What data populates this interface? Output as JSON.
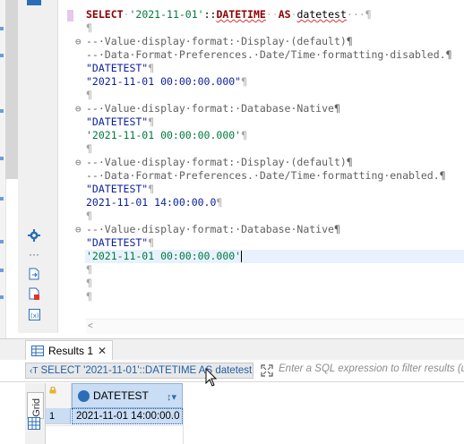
{
  "editor": {
    "lines": [
      {
        "type": "select",
        "kw1": "SELECT",
        "str": "'2021-11-01'",
        "op": "::",
        "kw2": "DATETIME",
        "kw3": "AS",
        "alias": "datetest",
        "trail": "···¶"
      },
      {
        "type": "blank",
        "text": "¶"
      },
      {
        "type": "comment",
        "fold": "⊖",
        "text": "--·Value·display·format:·Display·(default)¶"
      },
      {
        "type": "comment",
        "text": "--·Data·Format·Preferences.·Date/Time·formatting·disabled.¶"
      },
      {
        "type": "dq",
        "text": "\"DATETEST\"",
        "end": "¶"
      },
      {
        "type": "dq",
        "text": "\"2021-11-01 00:00:00.000\"",
        "end": "¶"
      },
      {
        "type": "blank",
        "text": "¶"
      },
      {
        "type": "comment",
        "fold": "⊖",
        "text": "--·Value·display·format:·Database·Native¶"
      },
      {
        "type": "dq",
        "text": "\"DATETEST\"",
        "end": "¶"
      },
      {
        "type": "sq",
        "text": "'2021-11-01 00:00:00.000'",
        "end": "¶"
      },
      {
        "type": "blank",
        "text": "¶"
      },
      {
        "type": "comment",
        "fold": "⊖",
        "text": "--·Value·display·format:·Display·(default)¶"
      },
      {
        "type": "comment",
        "text": "--·Data·Format·Preferences.·Date/Time·formatting·enabled.¶"
      },
      {
        "type": "dq",
        "text": "\"DATETEST\"",
        "end": "¶"
      },
      {
        "type": "plainline",
        "text": "2021-11-01 14:00:00.0",
        "end": "¶"
      },
      {
        "type": "blank",
        "text": "¶"
      },
      {
        "type": "comment",
        "fold": "⊖",
        "text": "--·Value·display·format:·Database·Native¶"
      },
      {
        "type": "dq",
        "text": "\"DATETEST\"",
        "end": "¶"
      },
      {
        "type": "sq",
        "text": "'2021-11-01 00:00:00.000'",
        "end": "",
        "current": true
      },
      {
        "type": "blank",
        "text": "¶"
      },
      {
        "type": "blank",
        "text": "¶"
      },
      {
        "type": "blank",
        "text": "¶"
      }
    ]
  },
  "results": {
    "tab_label": "Results 1",
    "query_label": "SELECT '2021-11-01'::DATETIME AS datetest",
    "query_icon": "‹T",
    "filter_placeholder": "Enter a SQL expression to filter results (u",
    "grid_label": "Grid",
    "column_header": "DATETEST",
    "rows": [
      {
        "num": "1",
        "value": "2021-11-01 14:00:00.0"
      }
    ]
  },
  "icons": [
    "settings-gear-icon",
    "more-dots-icon",
    "export-icon",
    "delete-icon",
    "variables-icon",
    "results-tab-icon",
    "close-icon",
    "filter-expand-icon",
    "lock-icon",
    "datetime-type-icon",
    "sort-icon",
    "grid-table-icon",
    "mouse-pointer-icon"
  ]
}
